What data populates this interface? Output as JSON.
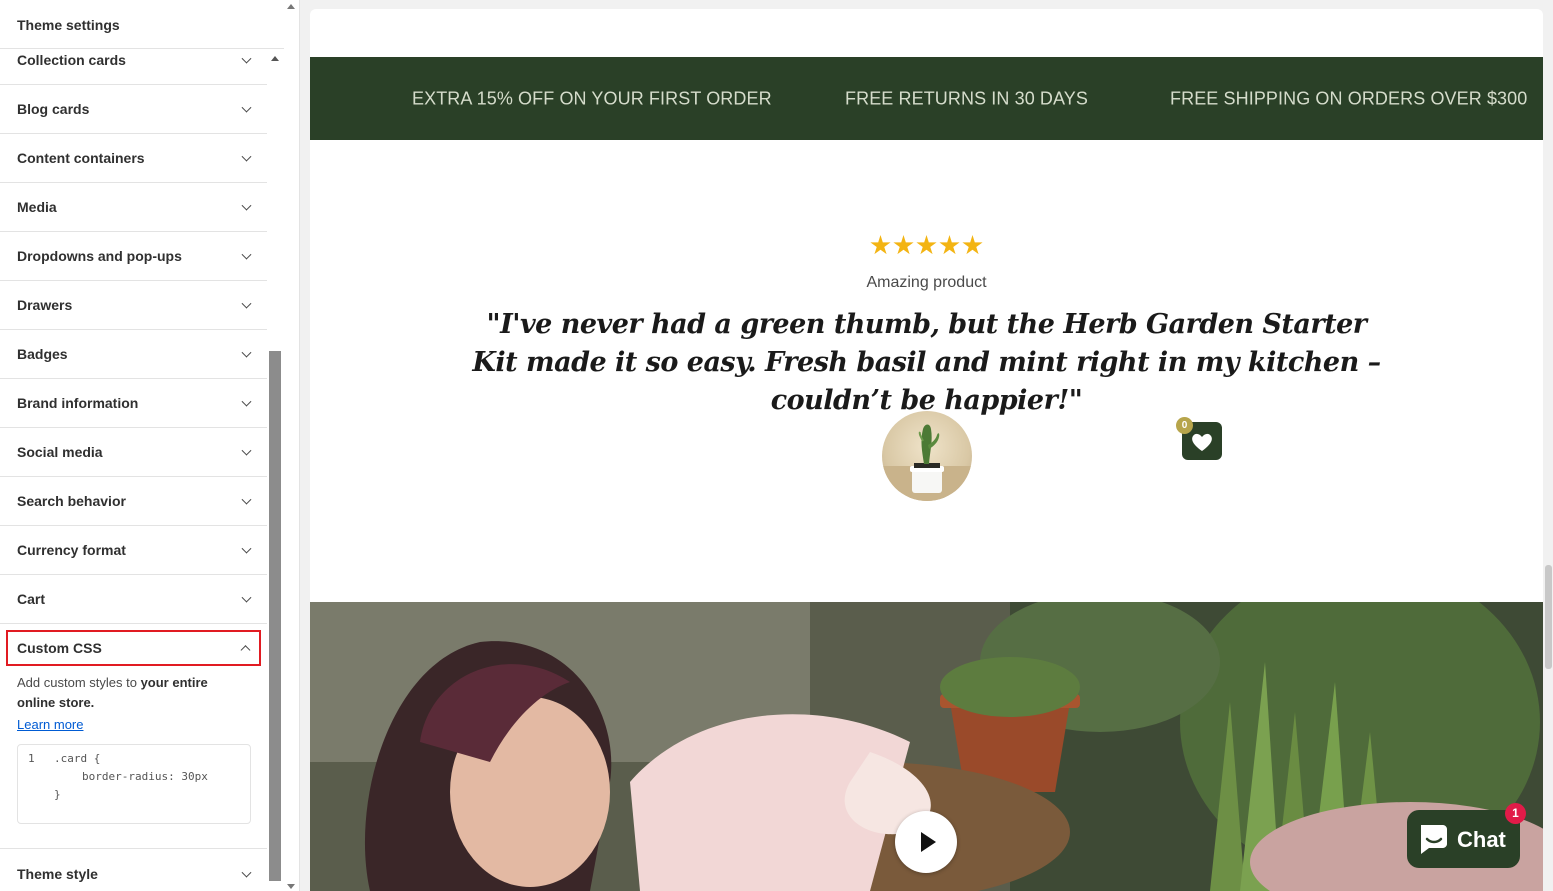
{
  "panel": {
    "title": "Theme settings",
    "sections": [
      "Collection cards",
      "Blog cards",
      "Content containers",
      "Media",
      "Dropdowns and pop-ups",
      "Drawers",
      "Badges",
      "Brand information",
      "Social media",
      "Search behavior",
      "Currency format",
      "Cart"
    ],
    "custom_css": {
      "label": "Custom CSS",
      "desc_prefix": "Add custom styles to ",
      "desc_bold": "your entire online store.",
      "learn_more": "Learn more",
      "code_line_number": "1",
      "code_line_1": ".card {",
      "code_line_2": "border-radius: 30px",
      "code_line_3": "}"
    },
    "theme_style": "Theme style"
  },
  "preview": {
    "announcements": [
      "EXTRA 15% OFF ON YOUR FIRST ORDER",
      "FREE RETURNS IN 30 DAYS",
      "FREE SHIPPING ON ORDERS OVER $300"
    ],
    "review": {
      "rating": 5,
      "title": "Amazing product",
      "quote": "\"I've never had a green thumb, but the Herb Garden Starter Kit made it so easy. Fresh basil and mint right in my kitchen – couldn’t be happier!\""
    },
    "wishlist_count": "0",
    "chat_label": "Chat",
    "chat_badge": "1"
  },
  "colors": {
    "accent_green": "#2a4027",
    "star": "#f3b413",
    "highlight": "#e11b22",
    "link": "#005bd3"
  }
}
